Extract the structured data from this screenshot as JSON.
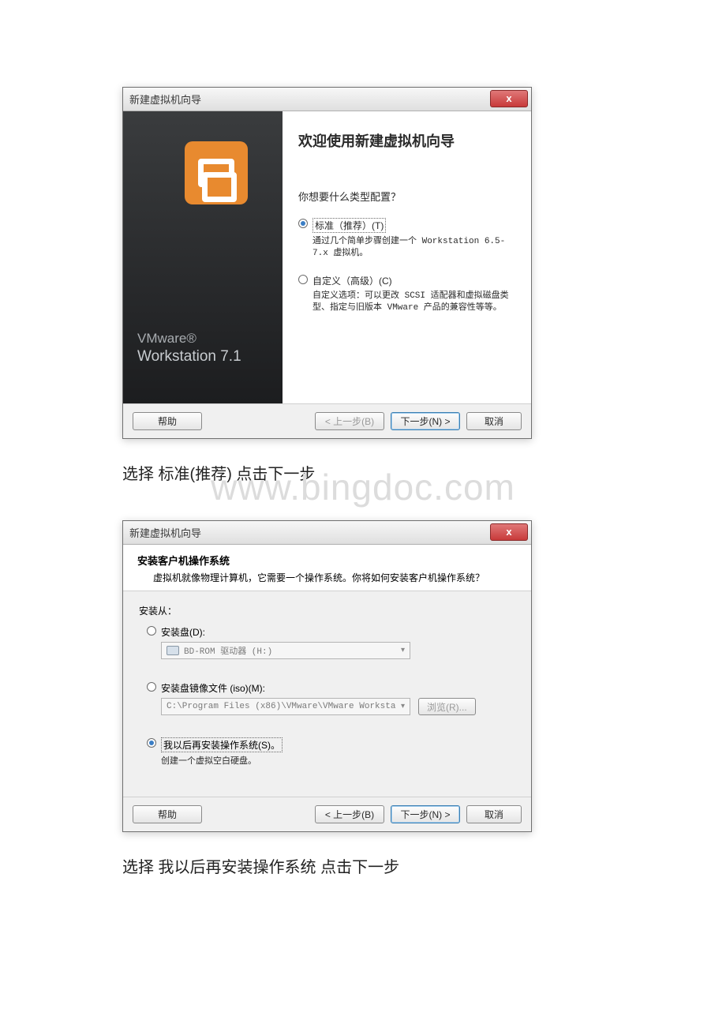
{
  "watermark": "www.bingdoc.com",
  "wizard1": {
    "title": "新建虚拟机向导",
    "close": "x",
    "brand": "VMware®",
    "brand_sub": "Workstation 7.1",
    "heading": "欢迎使用新建虚拟机向导",
    "question": "你想要什么类型配置？",
    "opt_standard": "标准（推荐）(T)",
    "opt_standard_desc": "通过几个简单步骤创建一个 Workstation 6.5-7.x 虚拟机。",
    "opt_custom": "自定义（高级）(C)",
    "opt_custom_desc": "自定义选项：可以更改 SCSI 适配器和虚拟磁盘类型、指定与旧版本 VMware 产品的兼容性等等。",
    "btn_help": "帮助",
    "btn_back": "< 上一步(B)",
    "btn_next": "下一步(N) >",
    "btn_cancel": "取消"
  },
  "caption1": "选择 标准(推荐) 点击下一步",
  "wizard2": {
    "title": "新建虚拟机向导",
    "close": "x",
    "header_title": "安装客户机操作系统",
    "header_desc": "虚拟机就像物理计算机，它需要一个操作系统。你将如何安装客户机操作系统？",
    "install_from": "安装从：",
    "opt_disc": "安装盘(D):",
    "disc_value": "BD-ROM 驱动器 (H:)",
    "opt_iso": "安装盘镜像文件 (iso)(M):",
    "iso_value": "C:\\Program Files (x86)\\VMware\\VMware Worksta",
    "browse": "浏览(R)...",
    "opt_later": "我以后再安装操作系统(S)。",
    "opt_later_desc": "创建一个虚拟空白硬盘。",
    "btn_help": "帮助",
    "btn_back": "< 上一步(B)",
    "btn_next": "下一步(N) >",
    "btn_cancel": "取消"
  },
  "caption2": "选择 我以后再安装操作系统 点击下一步"
}
